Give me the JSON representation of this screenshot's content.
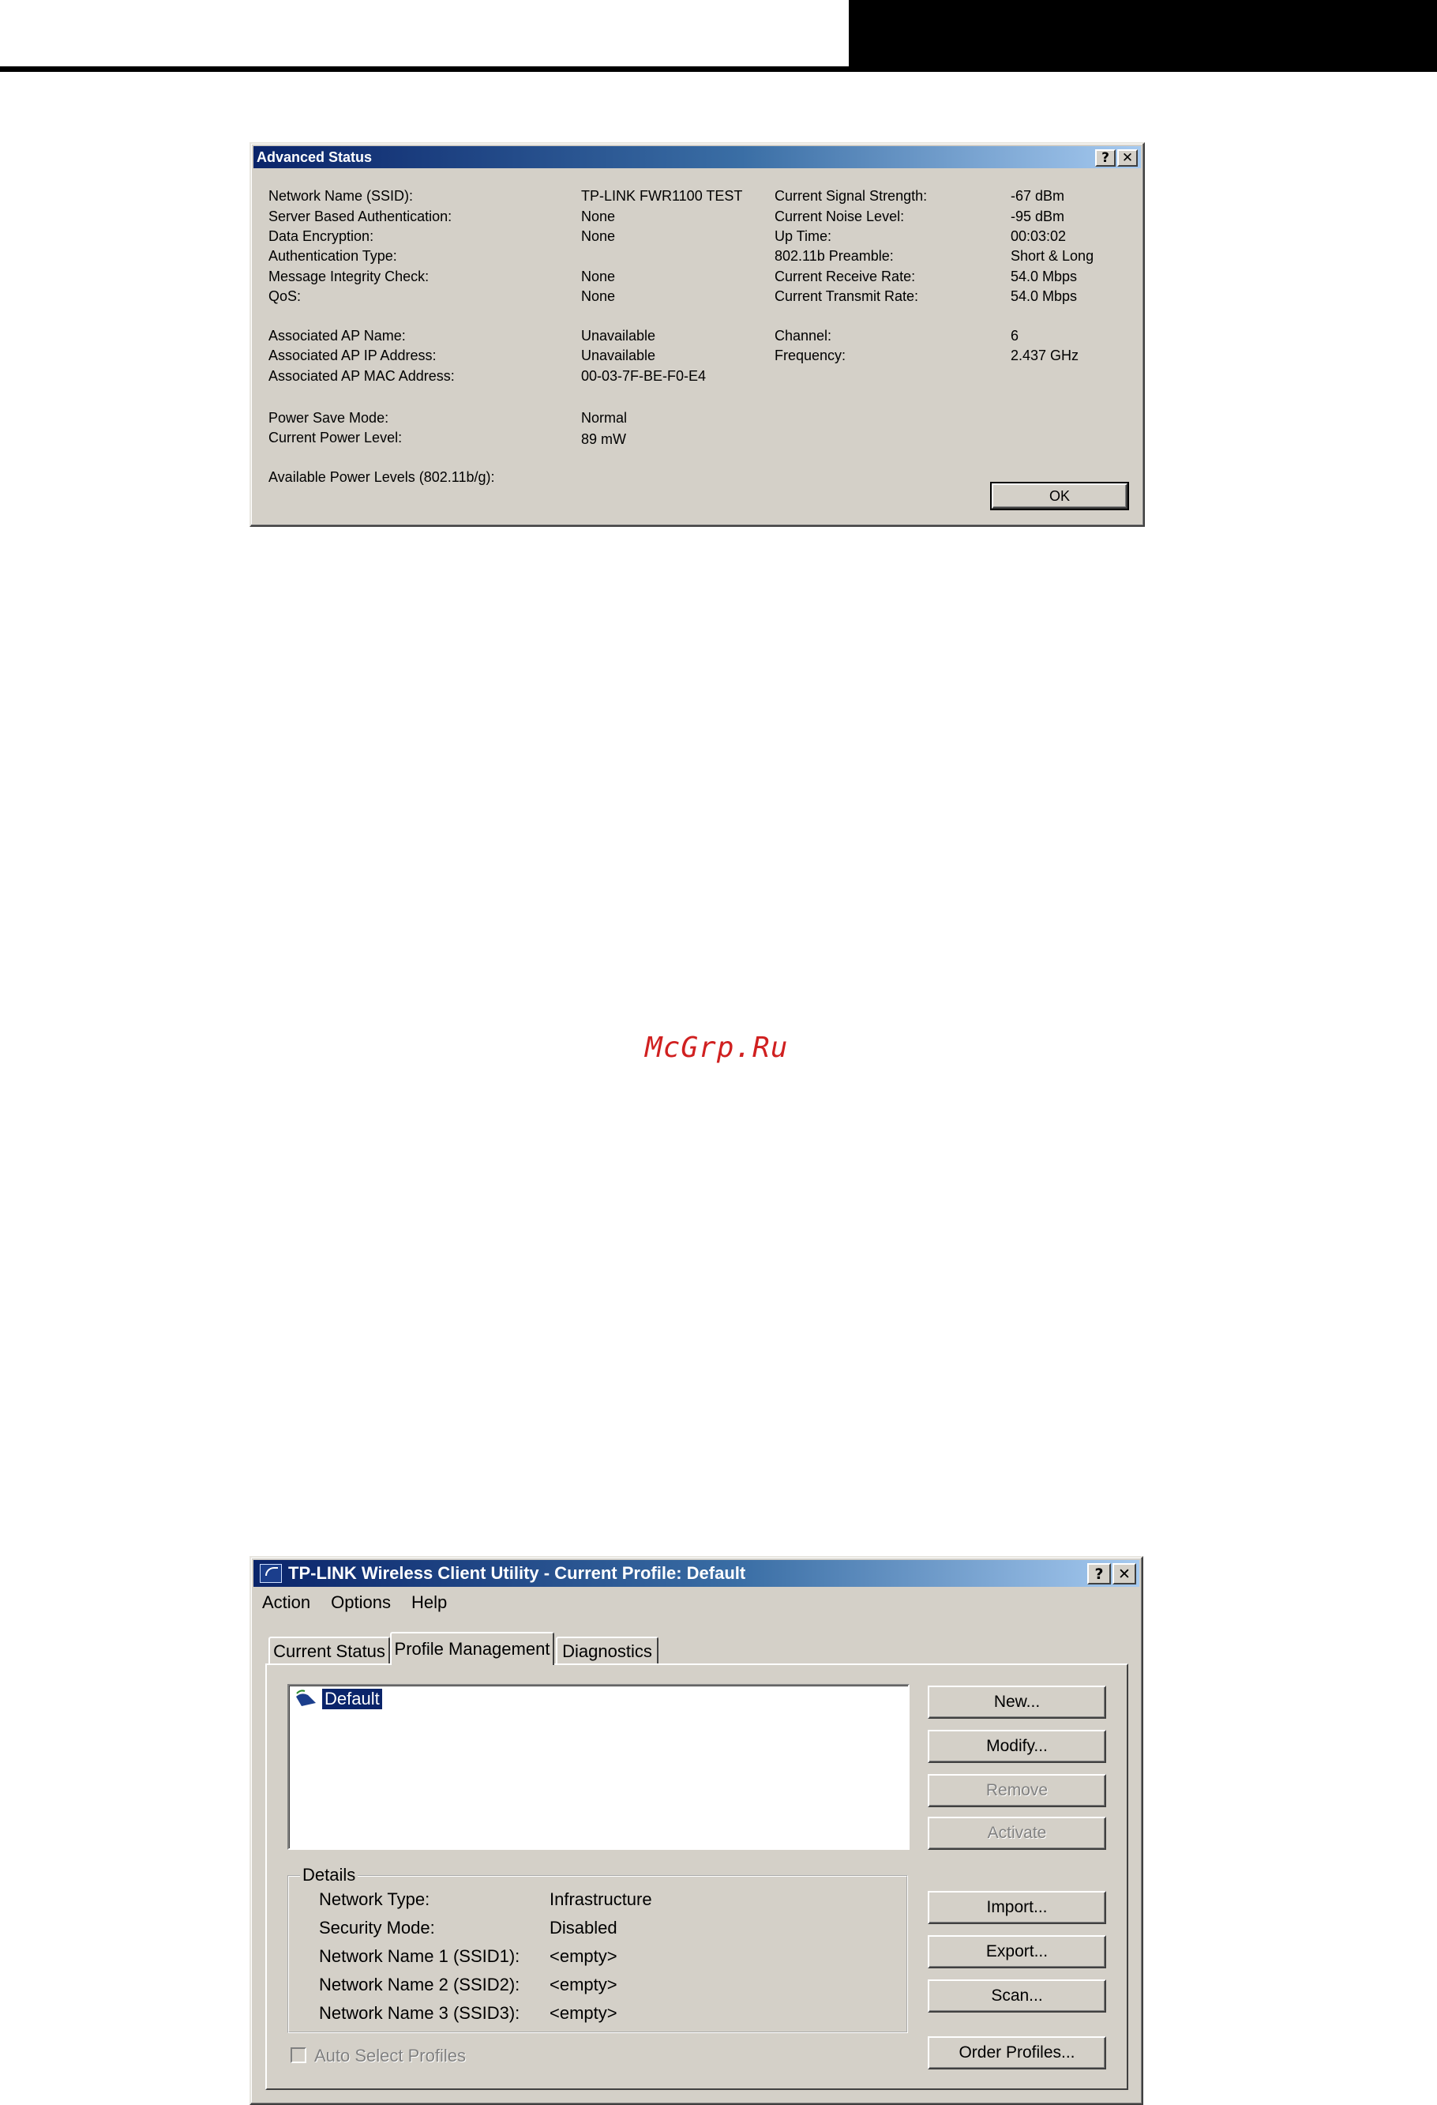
{
  "watermark": "McGrp.Ru",
  "advanced_status": {
    "title": "Advanced Status",
    "help_button": "?",
    "close_button": "✕",
    "left_labels": [
      "Network Name (SSID):",
      "Server Based Authentication:",
      "Data Encryption:",
      "Authentication Type:",
      "Message Integrity Check:",
      "QoS:",
      "Associated AP Name:",
      "Associated AP IP Address:",
      "Associated AP MAC Address:",
      "Power Save Mode:",
      "Current Power Level:",
      "Available Power Levels (802.11b/g):"
    ],
    "left_values": [
      "TP-LINK FWR1100 TEST",
      "None",
      "None",
      "",
      "None",
      "None",
      "Unavailable",
      "Unavailable",
      "00-03-7F-BE-F0-E4",
      "Normal",
      "89 mW"
    ],
    "right_labels": [
      "Current Signal Strength:",
      "Current Noise Level:",
      "Up Time:",
      "802.11b Preamble:",
      "Current Receive Rate:",
      "Current Transmit Rate:",
      "Channel:",
      "Frequency:"
    ],
    "right_values": [
      "-67 dBm",
      "-95 dBm",
      "00:03:02",
      "Short & Long",
      "54.0 Mbps",
      "54.0 Mbps",
      "6",
      "2.437 GHz"
    ],
    "ok_button": "OK"
  },
  "utility": {
    "title": "TP-LINK Wireless Client Utility - Current Profile: Default",
    "help_button": "?",
    "close_button": "✕",
    "menu": [
      "Action",
      "Options",
      "Help"
    ],
    "tabs": [
      "Current Status",
      "Profile Management",
      "Diagnostics"
    ],
    "profiles": [
      "Default"
    ],
    "buttons": [
      "New...",
      "Modify...",
      "Remove",
      "Activate",
      "Import...",
      "Export...",
      "Scan...",
      "Order Profiles..."
    ],
    "details": {
      "title": "Details",
      "rows": [
        {
          "label": "Network Type:",
          "value": "Infrastructure"
        },
        {
          "label": "Security Mode:",
          "value": "Disabled"
        },
        {
          "label": "Network Name 1 (SSID1):",
          "value": "<empty>"
        },
        {
          "label": "Network Name 2 (SSID2):",
          "value": "<empty>"
        },
        {
          "label": "Network Name 3 (SSID3):",
          "value": "<empty>"
        }
      ]
    },
    "auto_select": "Auto Select Profiles"
  }
}
